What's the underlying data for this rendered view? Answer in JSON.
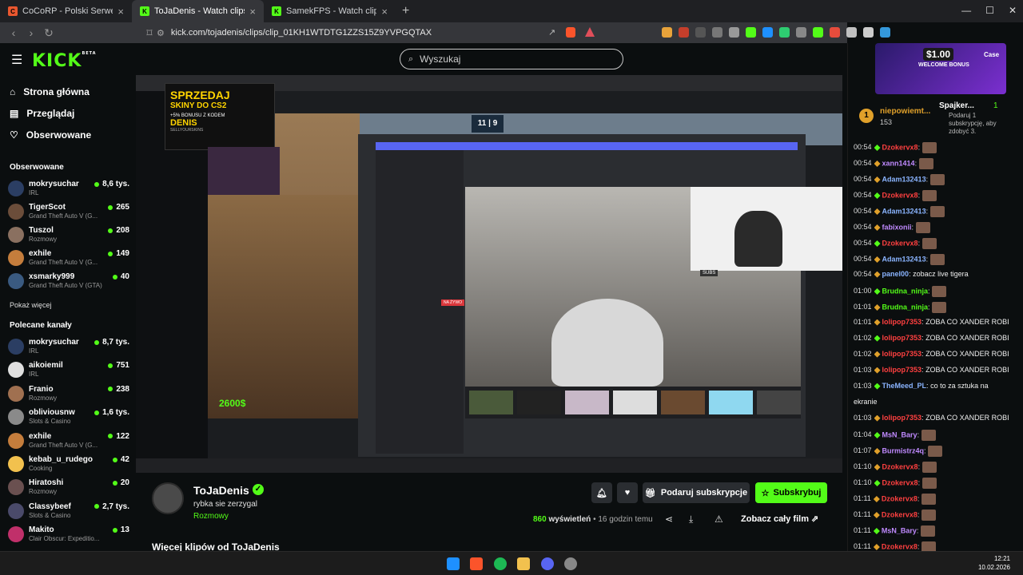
{
  "browser": {
    "tabs": [
      {
        "label": "CoCoRP - Polski Serwer GTA RP Whit",
        "fav": "C",
        "fav_color": "#e9572f",
        "active": false
      },
      {
        "label": "ToJaDenis - Watch clips on Kick",
        "fav": "K",
        "fav_color": "#53fc18",
        "active": true
      },
      {
        "label": "SamekFPS - Watch clips on Kick",
        "fav": "K",
        "fav_color": "#53fc18",
        "active": false
      }
    ],
    "new_tab": "+",
    "url": "kick.com/tojadenis/clips/clip_01KH1WTDTG1ZZS15Z9YVPGQTAX",
    "window_controls": [
      "—",
      "☐",
      "✕"
    ]
  },
  "kick": {
    "logo": "KICK",
    "logo_badge": "BETA",
    "search_placeholder": "Wyszukaj"
  },
  "sidebar": {
    "nav": [
      {
        "label": "Strona główna",
        "icon": "home-icon"
      },
      {
        "label": "Przeglądaj",
        "icon": "browse-icon"
      },
      {
        "label": "Obserwowane",
        "icon": "heart-icon"
      }
    ],
    "followed_title": "Obserwowane",
    "followed": [
      {
        "name": "mokrysuchar",
        "game": "IRL",
        "viewers": "8,6 tys.",
        "color": "#2b3e63"
      },
      {
        "name": "TigerScot",
        "game": "Grand Theft Auto V (G...",
        "viewers": "265",
        "color": "#6b4d3a"
      },
      {
        "name": "Tuszol",
        "game": "Rozmowy",
        "viewers": "208",
        "color": "#8a7060"
      },
      {
        "name": "exhile",
        "game": "Grand Theft Auto V (G...",
        "viewers": "149",
        "color": "#c47d3c"
      },
      {
        "name": "xsmarky999",
        "game": "Grand Theft Auto V (GTA)",
        "viewers": "40",
        "color": "#3a5a80"
      }
    ],
    "show_more": "Pokaż więcej",
    "recommended_title": "Polecane kanały",
    "recommended": [
      {
        "name": "mokrysuchar",
        "game": "IRL",
        "viewers": "8,7 tys.",
        "color": "#2b3e63"
      },
      {
        "name": "aikoiemil",
        "game": "IRL",
        "viewers": "751",
        "color": "#e0e0e0"
      },
      {
        "name": "Franio",
        "game": "Rozmowy",
        "viewers": "238",
        "color": "#a07050"
      },
      {
        "name": "obliviousnw",
        "game": "Slots & Casino",
        "viewers": "1,6 tys.",
        "color": "#8a8a8a"
      },
      {
        "name": "exhile",
        "game": "Grand Theft Auto V (G...",
        "viewers": "122",
        "color": "#c47d3c"
      },
      {
        "name": "kebab_u_rudego",
        "game": "Cooking",
        "viewers": "42",
        "color": "#f2c14e"
      },
      {
        "name": "Hiratoshi",
        "game": "Rozmowy",
        "viewers": "20",
        "color": "#6a5050"
      },
      {
        "name": "Classybeef",
        "game": "Slots & Casino",
        "viewers": "2,7 tys.",
        "color": "#4a4a6a"
      },
      {
        "name": "Makito",
        "game": "Clair Obscur: Expeditio...",
        "viewers": "13",
        "color": "#c0306a"
      }
    ]
  },
  "video": {
    "ad_title": "SPRZEDAJ",
    "ad_sub": "SKINY DO CS2",
    "ad_bonus": "+5% BONUSU Z KODEM",
    "ad_code": "DENIS",
    "ad_brand": "SELLYOURSKINS",
    "money": "2600$",
    "live_badge": "NA ŻYWO",
    "subs_label": "SUBS",
    "score_left": "11",
    "score_right": "9"
  },
  "clip": {
    "streamer": "ToJaDenis",
    "title": "rybka sie zerzygal",
    "category": "Rozmowy",
    "gift_label": "Podaruj subskrypcje",
    "subscribe_label": "Subskrybuj",
    "views_count": "860",
    "views_label": "wyświetleń",
    "time_ago": "• 16 godzin temu",
    "full_film_label": "Zobacz cały film",
    "more_clips": "Więcej klipów od ToJaDenis"
  },
  "chat": {
    "promo_amount": "$1.00",
    "promo_label": "WELCOME BONUS",
    "promo_brand": "Case",
    "top_gifter_name": "niepowiemt...",
    "top_gifter_count": "153",
    "second_gifter": "Spajker...",
    "second_count": "1",
    "gift_hint": "Podaruj 1 subskrypcję, aby zdobyć 3.",
    "messages": [
      {
        "time": "00:54",
        "user": "Dzokervx8",
        "color": "#ff4040",
        "text": "",
        "emote": true
      },
      {
        "time": "00:54",
        "user": "xann1414",
        "color": "#c08aff",
        "text": "",
        "emote": true
      },
      {
        "time": "00:54",
        "user": "Adam132413",
        "color": "#8ab4ff",
        "text": "",
        "emote": true
      },
      {
        "time": "00:54",
        "user": "Dzokervx8",
        "color": "#ff4040",
        "text": "",
        "emote": true
      },
      {
        "time": "00:54",
        "user": "Adam132413",
        "color": "#8ab4ff",
        "text": "",
        "emote": true
      },
      {
        "time": "00:54",
        "user": "fabixonii",
        "color": "#c08aff",
        "text": "",
        "emote": true
      },
      {
        "time": "00:54",
        "user": "Dzokervx8",
        "color": "#ff4040",
        "text": "",
        "emote": true
      },
      {
        "time": "00:54",
        "user": "Adam132413",
        "color": "#8ab4ff",
        "text": "",
        "emote": true
      },
      {
        "time": "00:54",
        "user": "panel00",
        "color": "#8ab4ff",
        "text": "zobacz live tigera",
        "emote": false
      },
      {
        "time": "01:00",
        "user": "Brudna_ninja",
        "color": "#53fc18",
        "text": "",
        "emote": true
      },
      {
        "time": "01:01",
        "user": "Brudna_ninja",
        "color": "#53fc18",
        "text": "",
        "emote": true
      },
      {
        "time": "01:01",
        "user": "lolipop7353",
        "color": "#ff4040",
        "text": "ZOBA CO XANDER ROBI",
        "emote": false
      },
      {
        "time": "01:02",
        "user": "lolipop7353",
        "color": "#ff4040",
        "text": "ZOBA CO XANDER ROBI",
        "emote": false
      },
      {
        "time": "01:02",
        "user": "lolipop7353",
        "color": "#ff4040",
        "text": "ZOBA CO XANDER ROBI",
        "emote": false
      },
      {
        "time": "01:03",
        "user": "lolipop7353",
        "color": "#ff4040",
        "text": "ZOBA CO XANDER ROBI",
        "emote": false
      },
      {
        "time": "01:03",
        "user": "TheMeed_PL",
        "color": "#8ab4ff",
        "text": "co to za sztuka na",
        "emote": false
      },
      {
        "time": "",
        "user": "",
        "color": "#fff",
        "text": "ekranie",
        "emote": false
      },
      {
        "time": "01:03",
        "user": "lolipop7353",
        "color": "#ff4040",
        "text": "ZOBA CO XANDER ROBI",
        "emote": false
      },
      {
        "time": "01:04",
        "user": "MsN_Bary",
        "color": "#c08aff",
        "text": "",
        "emote": true
      },
      {
        "time": "01:07",
        "user": "Burmistrz4q",
        "color": "#c08aff",
        "text": "",
        "emote": true
      },
      {
        "time": "01:10",
        "user": "Dzokervx8",
        "color": "#ff4040",
        "text": "",
        "emote": true
      },
      {
        "time": "01:10",
        "user": "Dzokervx8",
        "color": "#ff4040",
        "text": "",
        "emote": true
      },
      {
        "time": "01:11",
        "user": "Dzokervx8",
        "color": "#ff4040",
        "text": "",
        "emote": true
      },
      {
        "time": "01:11",
        "user": "Dzokervx8",
        "color": "#ff4040",
        "text": "",
        "emote": true
      },
      {
        "time": "01:11",
        "user": "MsN_Bary",
        "color": "#c08aff",
        "text": "",
        "emote": true
      },
      {
        "time": "01:11",
        "user": "Dzokervx8",
        "color": "#ff4040",
        "text": "",
        "emote": true
      }
    ]
  },
  "taskbar": {
    "time": "12:21",
    "date": "10.02.2026"
  }
}
